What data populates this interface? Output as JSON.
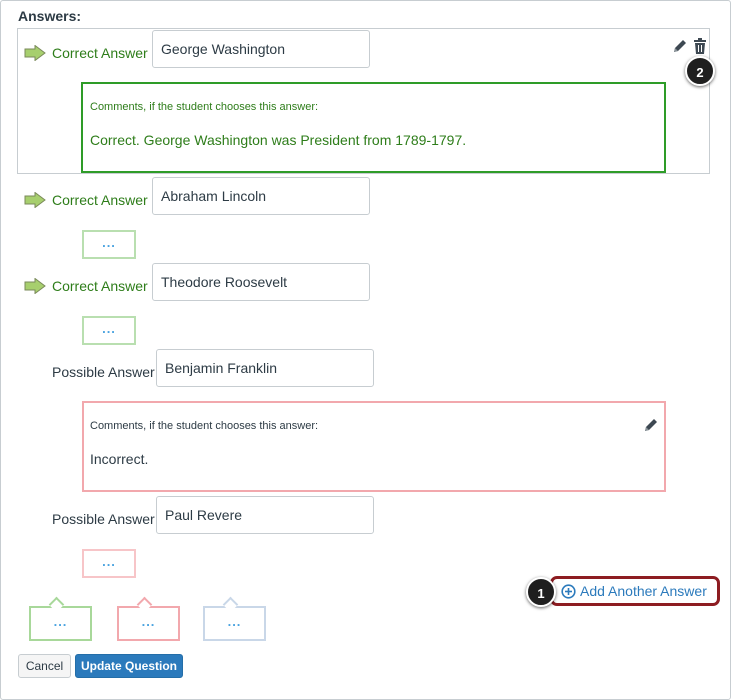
{
  "section": {
    "heading": "Answers:"
  },
  "answers": [
    {
      "kind": "correct",
      "label": "Correct Answer",
      "value": "George Washington",
      "comment_label": "Comments, if the student chooses this answer:",
      "comment": "Correct. George Washington was President from 1789-1797."
    },
    {
      "kind": "correct",
      "label": "Correct Answer",
      "value": "Abraham Lincoln",
      "comment_placeholder": "..."
    },
    {
      "kind": "correct",
      "label": "Correct Answer",
      "value": "Theodore Roosevelt",
      "comment_placeholder": "..."
    },
    {
      "kind": "possible",
      "label": "Possible Answer",
      "value": "Benjamin Franklin",
      "comment_label": "Comments, if the student chooses this answer:",
      "comment": "Incorrect."
    },
    {
      "kind": "possible",
      "label": "Possible Answer",
      "value": "Paul Revere",
      "comment_placeholder": "..."
    }
  ],
  "general_feedback": [
    {
      "placeholder": "...",
      "color": "#a8d89a"
    },
    {
      "placeholder": "...",
      "color": "#f2a8ad"
    },
    {
      "placeholder": "...",
      "color": "#c9d7e8"
    }
  ],
  "add_answer": {
    "label": "Add Another Answer"
  },
  "callouts": {
    "one": "1",
    "two": "2"
  },
  "buttons": {
    "cancel": "Cancel",
    "update": "Update Question"
  },
  "icons": {
    "correct_arrow": "arrow-right-icon",
    "edit": "pencil-icon",
    "delete": "trash-icon",
    "add": "plus-circle-icon"
  },
  "colors": {
    "correct": "#2e7d1a",
    "correct_border": "#2e9c28",
    "incorrect_border": "#f2a8ad",
    "link": "#2b7abc",
    "primary": "#2b7abc",
    "highlight": "#8d1c21"
  }
}
